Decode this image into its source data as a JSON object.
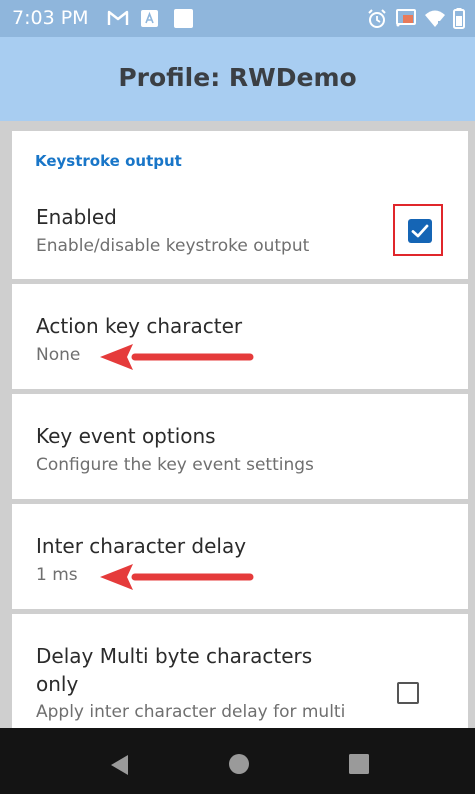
{
  "status_bar": {
    "time": "7:03 PM",
    "left_icons": [
      "gmail-icon",
      "app-badge-icon",
      "square-app-icon"
    ],
    "right_icons": [
      "alarm-icon",
      "cast-icon",
      "wifi-icon",
      "battery-icon"
    ]
  },
  "app_bar": {
    "title": "Profile: RWDemo"
  },
  "settings": {
    "section_header": "Keystroke output",
    "items": [
      {
        "title": "Enabled",
        "subtitle": "Enable/disable keystroke output",
        "checkbox": true
      },
      {
        "title": "Action key character",
        "subtitle": "None"
      },
      {
        "title": "Key event options",
        "subtitle": "Configure the key event settings"
      },
      {
        "title": "Inter character delay",
        "subtitle": "1 ms"
      },
      {
        "title_line1": "Delay Multi byte characters",
        "title_line2": "only",
        "subtitle": "Apply inter character delay for multi",
        "checkbox": false
      }
    ]
  },
  "annotations": {
    "arrow_color": "#e53b3b",
    "highlight_color": "#e0262b"
  },
  "nav_bar": {
    "buttons": [
      "back-icon",
      "home-icon",
      "recents-icon"
    ]
  },
  "colors": {
    "status_bar": "#8fb6dc",
    "app_bar": "#a8cdf1",
    "accent": "#1976c8",
    "checkbox": "#1565b5"
  }
}
